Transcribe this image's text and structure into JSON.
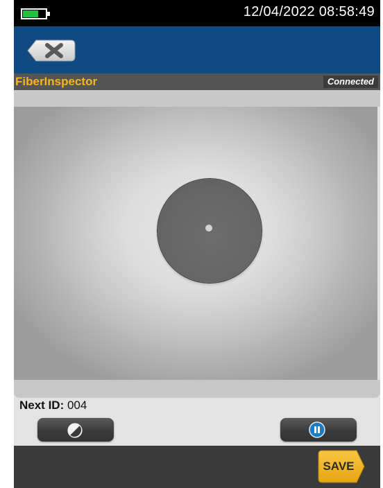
{
  "status_bar": {
    "battery_level": 0.7,
    "datetime": "12/04/2022 08:58:49"
  },
  "nav": {
    "back_icon": "back-clear-icon"
  },
  "title_bar": {
    "app_title": "FiberInspector",
    "connection_status": "Connected"
  },
  "inspection": {
    "next_id_label": "Next ID:",
    "next_id_value": "004"
  },
  "controls": {
    "left_icon": "contrast-icon",
    "right_icon": "pause-icon"
  },
  "footer": {
    "save_label": "SAVE"
  },
  "colors": {
    "nav_blue": "#0f4a82",
    "title_gold": "#f5b51d",
    "battery_green": "#22c03c",
    "save_gold": "#f3b620",
    "pause_blue": "#1a7cc8"
  }
}
